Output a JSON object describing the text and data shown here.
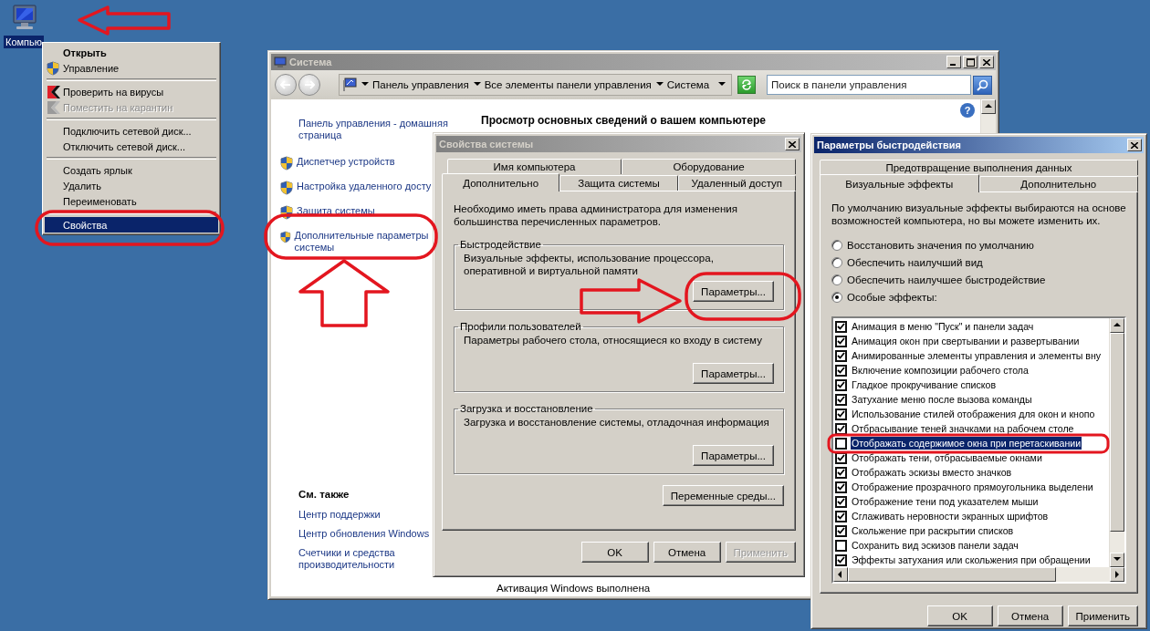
{
  "desktop_icon": {
    "label": "Компью",
    "selected": true
  },
  "context_menu": {
    "groups": [
      [
        {
          "kind": "plain",
          "label": "Открыть",
          "default": true,
          "disabled": false,
          "selected": false
        },
        {
          "kind": "shield",
          "label": "Управление",
          "default": false,
          "disabled": false,
          "selected": false
        }
      ],
      [
        {
          "kind": "antivirus",
          "label": "Проверить на вирусы",
          "default": false,
          "disabled": false,
          "selected": false
        },
        {
          "kind": "antivirus",
          "label": "Поместить на карантин",
          "default": false,
          "disabled": true,
          "selected": false
        }
      ],
      [
        {
          "kind": "plain",
          "label": "Подключить сетевой диск...",
          "default": false,
          "disabled": false,
          "selected": false
        },
        {
          "kind": "plain",
          "label": "Отключить сетевой диск...",
          "default": false,
          "disabled": false,
          "selected": false
        }
      ],
      [
        {
          "kind": "plain",
          "label": "Создать ярлык",
          "default": false,
          "disabled": false,
          "selected": false
        },
        {
          "kind": "plain",
          "label": "Удалить",
          "default": false,
          "disabled": false,
          "selected": false
        },
        {
          "kind": "plain",
          "label": "Переименовать",
          "default": false,
          "disabled": false,
          "selected": false
        }
      ],
      [
        {
          "kind": "plain",
          "label": "Свойства",
          "default": false,
          "disabled": false,
          "selected": true
        }
      ]
    ]
  },
  "system_window": {
    "title": "Система",
    "active": false,
    "address": {
      "crumbs": [
        "Панель управления",
        "Все элементы панели управления",
        "Система"
      ]
    },
    "search": {
      "placeholder": "Поиск в панели управления"
    },
    "help": "?",
    "sidebar": {
      "home_link": "Панель управления - домашняя страница",
      "tasks": [
        "Диспетчер устройств",
        "Настройка удаленного досту",
        "Защита системы",
        "Дополнительные параметры системы"
      ],
      "see_also_title": "См. также",
      "see_also": [
        "Центр поддержки",
        "Центр обновления Windows",
        "Счетчики и средства производительности"
      ]
    },
    "heading": "Просмотр основных сведений о вашем компьютере",
    "status_text": "Активация Windows выполнена"
  },
  "system_properties": {
    "title": "Свойства системы",
    "active": false,
    "tab_rows": [
      [
        {
          "label": "Имя компьютера",
          "selected": false
        },
        {
          "label": "Оборудование",
          "selected": false
        }
      ],
      [
        {
          "label": "Дополнительно",
          "selected": true
        },
        {
          "label": "Защита системы",
          "selected": false
        },
        {
          "label": "Удаленный доступ",
          "selected": false
        }
      ]
    ],
    "intro": "Необходимо иметь права администратора для изменения большинства перечисленных параметров.",
    "groups": [
      {
        "title": "Быстродействие",
        "description": "Визуальные эффекты, использование процессора, оперативной и виртуальной памяти",
        "button": "Параметры..."
      },
      {
        "title": "Профили пользователей",
        "description": "Параметры рабочего стола, относящиеся ко входу в систему",
        "button": "Параметры..."
      },
      {
        "title": "Загрузка и восстановление",
        "description": "Загрузка и восстановление системы, отладочная информация",
        "button": "Параметры..."
      }
    ],
    "env_button": "Переменные среды...",
    "buttons": [
      {
        "label": "OK",
        "disabled": false
      },
      {
        "label": "Отмена",
        "disabled": false
      },
      {
        "label": "Применить",
        "disabled": true
      }
    ]
  },
  "performance_options": {
    "title": "Параметры быстродействия",
    "active": true,
    "tab_rows": [
      [
        {
          "label": "Предотвращение выполнения данных",
          "selected": false
        }
      ],
      [
        {
          "label": "Визуальные эффекты",
          "selected": true
        },
        {
          "label": "Дополнительно",
          "selected": false
        }
      ]
    ],
    "description": "По умолчанию визуальные эффекты выбираются на основе возможностей компьютера, но вы можете изменить их.",
    "radios": [
      {
        "label": "Восстановить значения по умолчанию",
        "selected": false
      },
      {
        "label": "Обеспечить наилучший вид",
        "selected": false
      },
      {
        "label": "Обеспечить наилучшее быстродействие",
        "selected": false
      },
      {
        "label": "Особые эффекты:",
        "selected": true
      }
    ],
    "effects": [
      {
        "label": "Анимация в меню \"Пуск\" и панели задач",
        "checked": true,
        "selected": false
      },
      {
        "label": "Анимация окон при свертывании и развертывании",
        "checked": true,
        "selected": false
      },
      {
        "label": "Анимированные элементы управления и элементы вну",
        "checked": true,
        "selected": false
      },
      {
        "label": "Включение композиции рабочего стола",
        "checked": true,
        "selected": false
      },
      {
        "label": "Гладкое прокручивание списков",
        "checked": true,
        "selected": false
      },
      {
        "label": "Затухание меню после вызова команды",
        "checked": true,
        "selected": false
      },
      {
        "label": "Использование стилей отображения для окон и кнопо",
        "checked": true,
        "selected": false
      },
      {
        "label": "Отбрасывание теней значками на рабочем столе",
        "checked": true,
        "selected": false
      },
      {
        "label": "Отображать содержимое окна при перетаскивании",
        "checked": false,
        "selected": true
      },
      {
        "label": "Отображать тени, отбрасываемые окнами",
        "checked": true,
        "selected": false
      },
      {
        "label": "Отображать эскизы вместо значков",
        "checked": true,
        "selected": false
      },
      {
        "label": "Отображение прозрачного прямоугольника выделени",
        "checked": true,
        "selected": false
      },
      {
        "label": "Отображение тени под указателем мыши",
        "checked": true,
        "selected": false
      },
      {
        "label": "Сглаживать неровности экранных шрифтов",
        "checked": true,
        "selected": false
      },
      {
        "label": "Скольжение при раскрытии списков",
        "checked": true,
        "selected": false
      },
      {
        "label": "Сохранить вид эскизов панели задач",
        "checked": false,
        "selected": false
      },
      {
        "label": "Эффекты затухания или скольжения при обращении",
        "checked": true,
        "selected": false
      }
    ],
    "buttons": [
      {
        "label": "OK",
        "disabled": false
      },
      {
        "label": "Отмена",
        "disabled": false
      },
      {
        "label": "Применить",
        "disabled": false
      }
    ]
  }
}
